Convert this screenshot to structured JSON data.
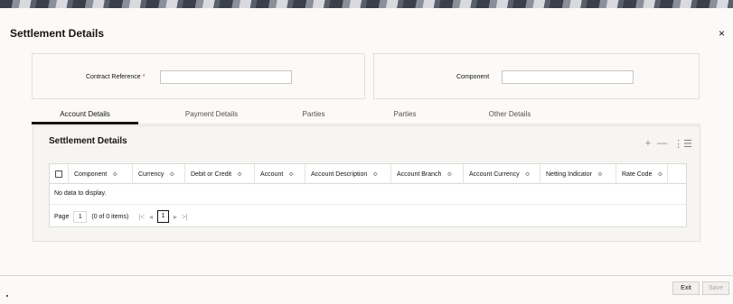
{
  "dialog": {
    "title": "Settlement Details",
    "close_label": "×"
  },
  "fields": {
    "contract_reference": {
      "label": "Contract Reference",
      "required_mark": "*",
      "value": ""
    },
    "component": {
      "label": "Component",
      "value": ""
    }
  },
  "tabs": [
    {
      "label": "Account Details",
      "active": true
    },
    {
      "label": "Payment Details",
      "active": false
    },
    {
      "label": "Parties",
      "active": false
    },
    {
      "label": "Parties",
      "active": false
    },
    {
      "label": "Other Details",
      "active": false
    }
  ],
  "panel": {
    "title": "Settlement Details",
    "toolbar": {
      "add": "+",
      "remove": "—",
      "columns": "⋮☰"
    }
  },
  "grid": {
    "columns": [
      "Component",
      "Currency",
      "Debit or Credit",
      "Account",
      "Account Description",
      "Account Branch",
      "Account Currency",
      "Netting Indicator",
      "Rate Code"
    ],
    "sort_glyph": "≎",
    "empty_message": "No data to display.",
    "pager": {
      "page_label": "Page",
      "page_value": "1",
      "summary": "(0 of 0 items)",
      "first": "|<",
      "prev": "◂",
      "current": "1",
      "next": "▸",
      "last": ">|"
    }
  },
  "footer": {
    "exit_label": "Exit",
    "save_label": "Save"
  },
  "colors": {
    "background": "#fbfaf8",
    "text": "#161513",
    "border": "#e3e1dd",
    "disabled": "#a9a6a0"
  }
}
